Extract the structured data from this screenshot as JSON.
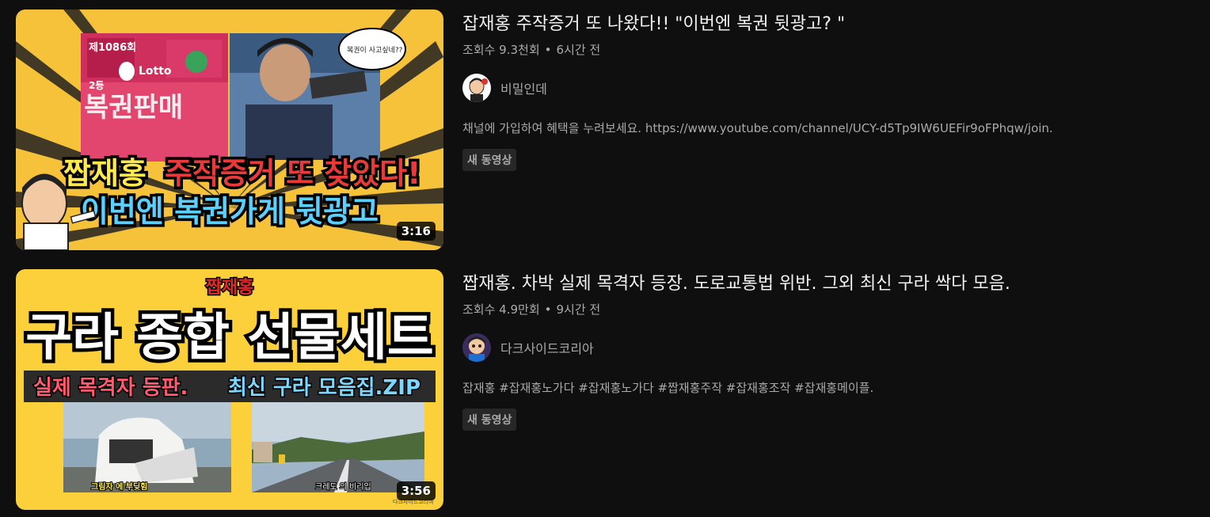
{
  "videos": [
    {
      "title": "잡재홍 주작증거 또 나왔다!! \"이번엔 복권 뒷광고? \"",
      "views": "조회수 9.3천회",
      "separator": "•",
      "age": "6시간 전",
      "channel": "비밀인데",
      "description": "채널에 가입하여 혜택을 누려보세요. https://www.youtube.com/channel/UCY-d5Tp9IW6UEFir9oFPhqw/join.",
      "badge": "새 동영상",
      "duration": "3:16",
      "thumbnail": {
        "line1a": "짭재홍",
        "line1b": "주작증거 또 찾았다!",
        "line2": "이번엔 복권가게 뒷광고",
        "sign": "복권판매",
        "lotto1": "제1086회",
        "lotto2": "Lotto",
        "lotto3": "2등",
        "bubble": "복권이 사고싶네??"
      }
    },
    {
      "title": "짭재홍. 차박 실제 목격자 등장. 도로교통법 위반. 그외 최신 구라 싹다 모음.",
      "views": "조회수 4.9만회",
      "separator": "•",
      "age": "9시간 전",
      "channel": "다크사이드코리아",
      "description": "잡재홍 #잡재홍노가다 #잡재홍노가다 #짭재홍주작 #잡재홍조작 #잡재홍메이플.",
      "badge": "새 동영상",
      "duration": "3:56",
      "thumbnail": {
        "top": "짭재홍",
        "headline": "구라 종합 선물세트",
        "strip_red": "실제 목격자 등판.",
        "strip_blue": "최신 구라 모음집.ZIP",
        "caption_left": "그림자 에 부딪힘",
        "caption_right": "크레도 의 비리입",
        "watermark": "다크사이드코리아"
      }
    }
  ],
  "colors": {
    "background": "#0f0f0f",
    "title": "#f1f1f1",
    "secondary": "#aaaaaa",
    "badge_bg": "#272727",
    "thumb1_bg": "#f5c23a",
    "thumb2_bg": "#fcd03a"
  }
}
